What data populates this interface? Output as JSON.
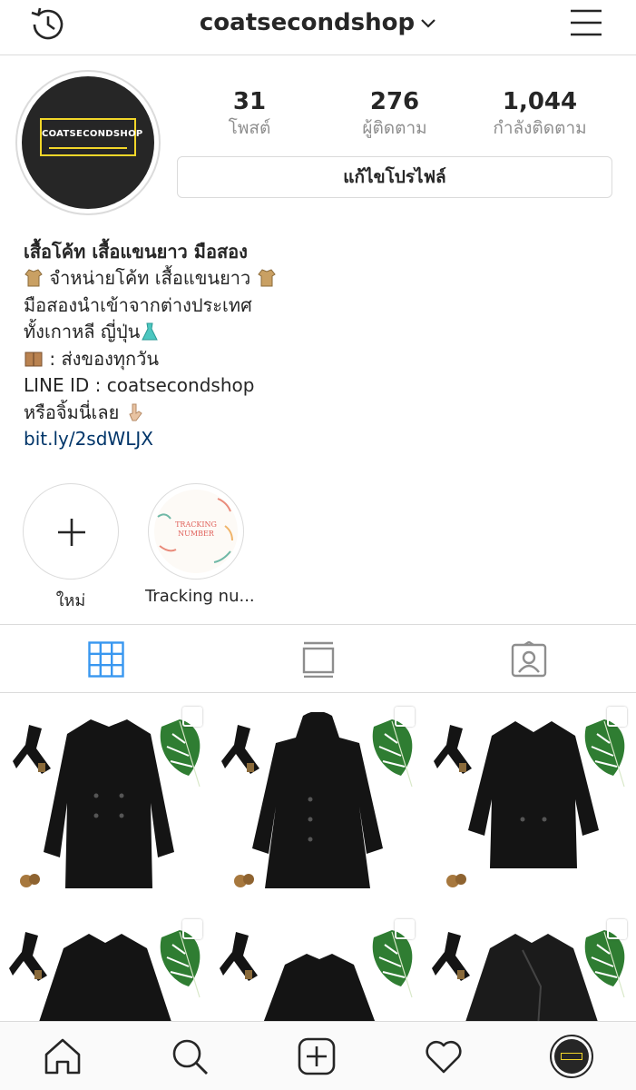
{
  "header": {
    "username": "coatsecondshop",
    "history_icon": "history-icon",
    "dropdown_icon": "chevron-down-icon",
    "menu_icon": "hamburger-menu-icon"
  },
  "profile": {
    "avatar_text": "COATSECONDSHOP",
    "stats": [
      {
        "value": "31",
        "label": "โพสต์"
      },
      {
        "value": "276",
        "label": "ผู้ติดตาม"
      },
      {
        "value": "1,044",
        "label": "กำลังติดตาม"
      }
    ],
    "edit_button": "แก้ไขโปรไฟล์"
  },
  "bio": {
    "name": "เสื้อโค้ท เสื้อแขนยาว มือสอง",
    "line1": "จำหน่ายโค้ท เสื้อแขนยาว",
    "line2": "มือสองนำเข้าจากต่างประเทศ",
    "line3": "ทั้งเกาหลี ญี่ปุ่น",
    "line4": ": ส่งของทุกวัน",
    "line5": "LINE ID : coatsecondshop",
    "line6": "หรือจิ้มนี่เลย",
    "link": "bit.ly/2sdWLJX"
  },
  "highlights": [
    {
      "label": "ใหม่",
      "icon": "plus-icon"
    },
    {
      "label": "Tracking nu...",
      "cover_text_1": "TRACKING",
      "cover_text_2": "NUMBER"
    }
  ],
  "tabs": [
    {
      "icon": "grid-icon",
      "active": true
    },
    {
      "icon": "feed-icon",
      "active": false
    },
    {
      "icon": "tagged-icon",
      "active": false
    }
  ],
  "bottom_nav": [
    {
      "icon": "home-icon"
    },
    {
      "icon": "search-icon"
    },
    {
      "icon": "add-post-icon"
    },
    {
      "icon": "heart-icon"
    },
    {
      "icon": "profile-avatar-icon"
    }
  ],
  "colors": {
    "accent_blue": "#3897f0",
    "link_blue": "#003569",
    "brand_yellow": "#f2d629",
    "text": "#262626",
    "muted": "#8e8e8e",
    "border": "#dbdbdb"
  }
}
